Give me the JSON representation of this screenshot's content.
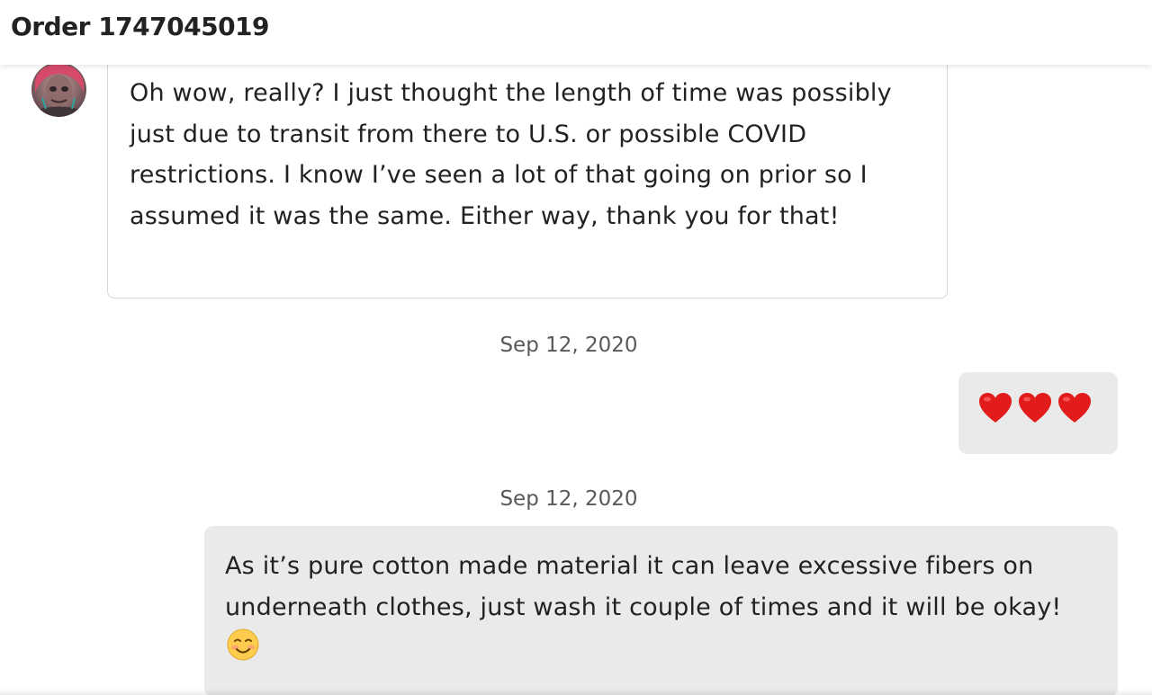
{
  "header": {
    "title": "Order 1747045019"
  },
  "messages": {
    "incoming": {
      "text": "Oh wow, really? I just thought the length of time was possibly just due to transit from there to U.S. or possible COVID restrictions. I know I’ve seen a lot of that going on prior so I assumed it was the same. Either way, thank you for that!",
      "avatar_icon": "user-avatar"
    },
    "date_1": "Sep 12, 2020",
    "outgoing_hearts": {
      "emoji": [
        "❤️",
        "❤️",
        "❤️"
      ]
    },
    "date_2": "Sep 12, 2020",
    "outgoing_text": {
      "text": "As it’s pure cotton made material it can leave excessive fibers on underneath clothes, just wash it couple of times and it will be okay!",
      "trailing_emoji": "☺️"
    }
  },
  "colors": {
    "outgoing_bubble": "#eaeaea",
    "incoming_border": "#d6d6d6",
    "text": "#222222",
    "date": "#595959",
    "heart": "#e21b1b"
  }
}
